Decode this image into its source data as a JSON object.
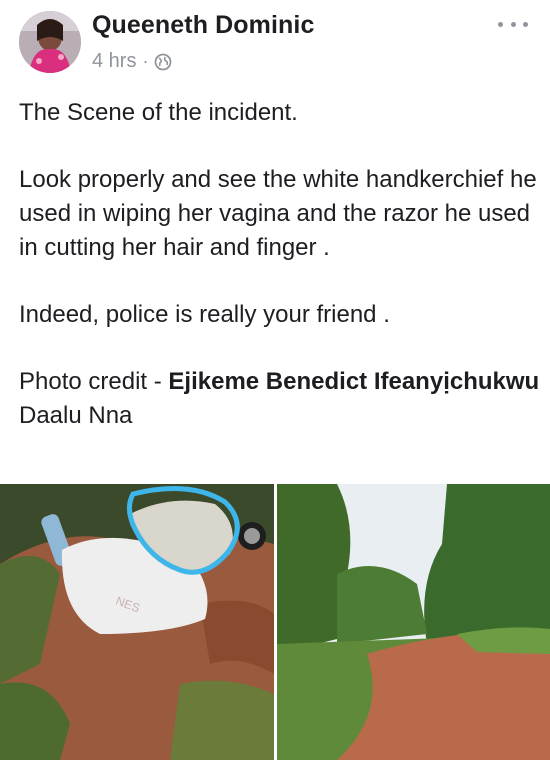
{
  "post": {
    "author": "Queeneth Dominic",
    "time": "4 hrs",
    "separator": "·",
    "privacy_icon": "globe-icon",
    "more_icon": "more-options-icon"
  },
  "body": {
    "line1": "The Scene of the incident.",
    "para2": "Look properly and see the white handkerchief he used in wiping her vagina and the razor he used in cutting her hair and finger .",
    "para3": "Indeed, police is really your friend .",
    "credit_prefix": "Photo credit - ",
    "credit_name": "Ejikeme Benedict Ifeanyịchukwu",
    "credit_suffix": " Daalu Nna"
  },
  "photos": [
    {
      "name": "scene-photo-left",
      "desc_icon": "photo"
    },
    {
      "name": "scene-photo-right",
      "desc_icon": "photo"
    }
  ],
  "colors": {
    "text": "#1c1e21",
    "meta": "#90949c",
    "highlight_circle": "#3fb6ea"
  }
}
